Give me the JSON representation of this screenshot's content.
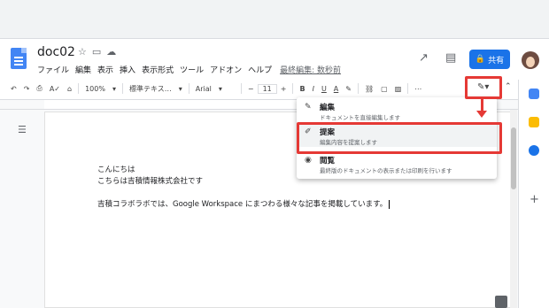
{
  "document": {
    "title": "doc02",
    "menu": [
      "ファイル",
      "編集",
      "表示",
      "挿入",
      "表示形式",
      "ツール",
      "アドオン",
      "ヘルプ"
    ],
    "last_edit": "最終編集: 数秒前"
  },
  "header": {
    "share_label": "共有"
  },
  "toolbar": {
    "zoom": "100%",
    "style": "標準テキス…",
    "font": "Arial",
    "font_size": "11",
    "minus": "−",
    "plus": "+",
    "bold": "B",
    "italic": "I",
    "underline": "U",
    "text_color": "A"
  },
  "body": {
    "lines": [
      "こんにちは",
      "こちらは吉積情報株式会社です",
      "",
      "吉積コラボラボでは、Google Workspace にまつわる様々な記事を掲載しています。"
    ]
  },
  "mode_menu": {
    "items": [
      {
        "label": "編集",
        "description": "ドキュメントを直接編集します",
        "icon": "pencil-icon"
      },
      {
        "label": "提案",
        "description": "編集内容を提案します",
        "icon": "suggest-icon"
      },
      {
        "label": "閲覧",
        "description": "最終版のドキュメントの表示または印刷を行います",
        "icon": "eye-icon"
      }
    ]
  },
  "colors": {
    "accent": "#1a73e8",
    "highlight": "#e53935"
  }
}
